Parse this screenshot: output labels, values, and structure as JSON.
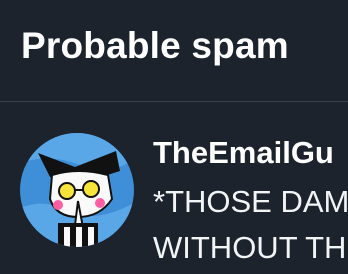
{
  "header": {
    "title": "Probable spam"
  },
  "messages": [
    {
      "sender": "TheEmailGu",
      "preview_line_1": "*THOSE DAM",
      "preview_line_2": "WITHOUT TH",
      "avatar_icon": "cartoon-character-avatar-icon"
    }
  ],
  "colors": {
    "background": "#1c232c",
    "divider": "#3a434d",
    "text": "#ffffff",
    "avatar_bg": "#3f8fd8"
  }
}
